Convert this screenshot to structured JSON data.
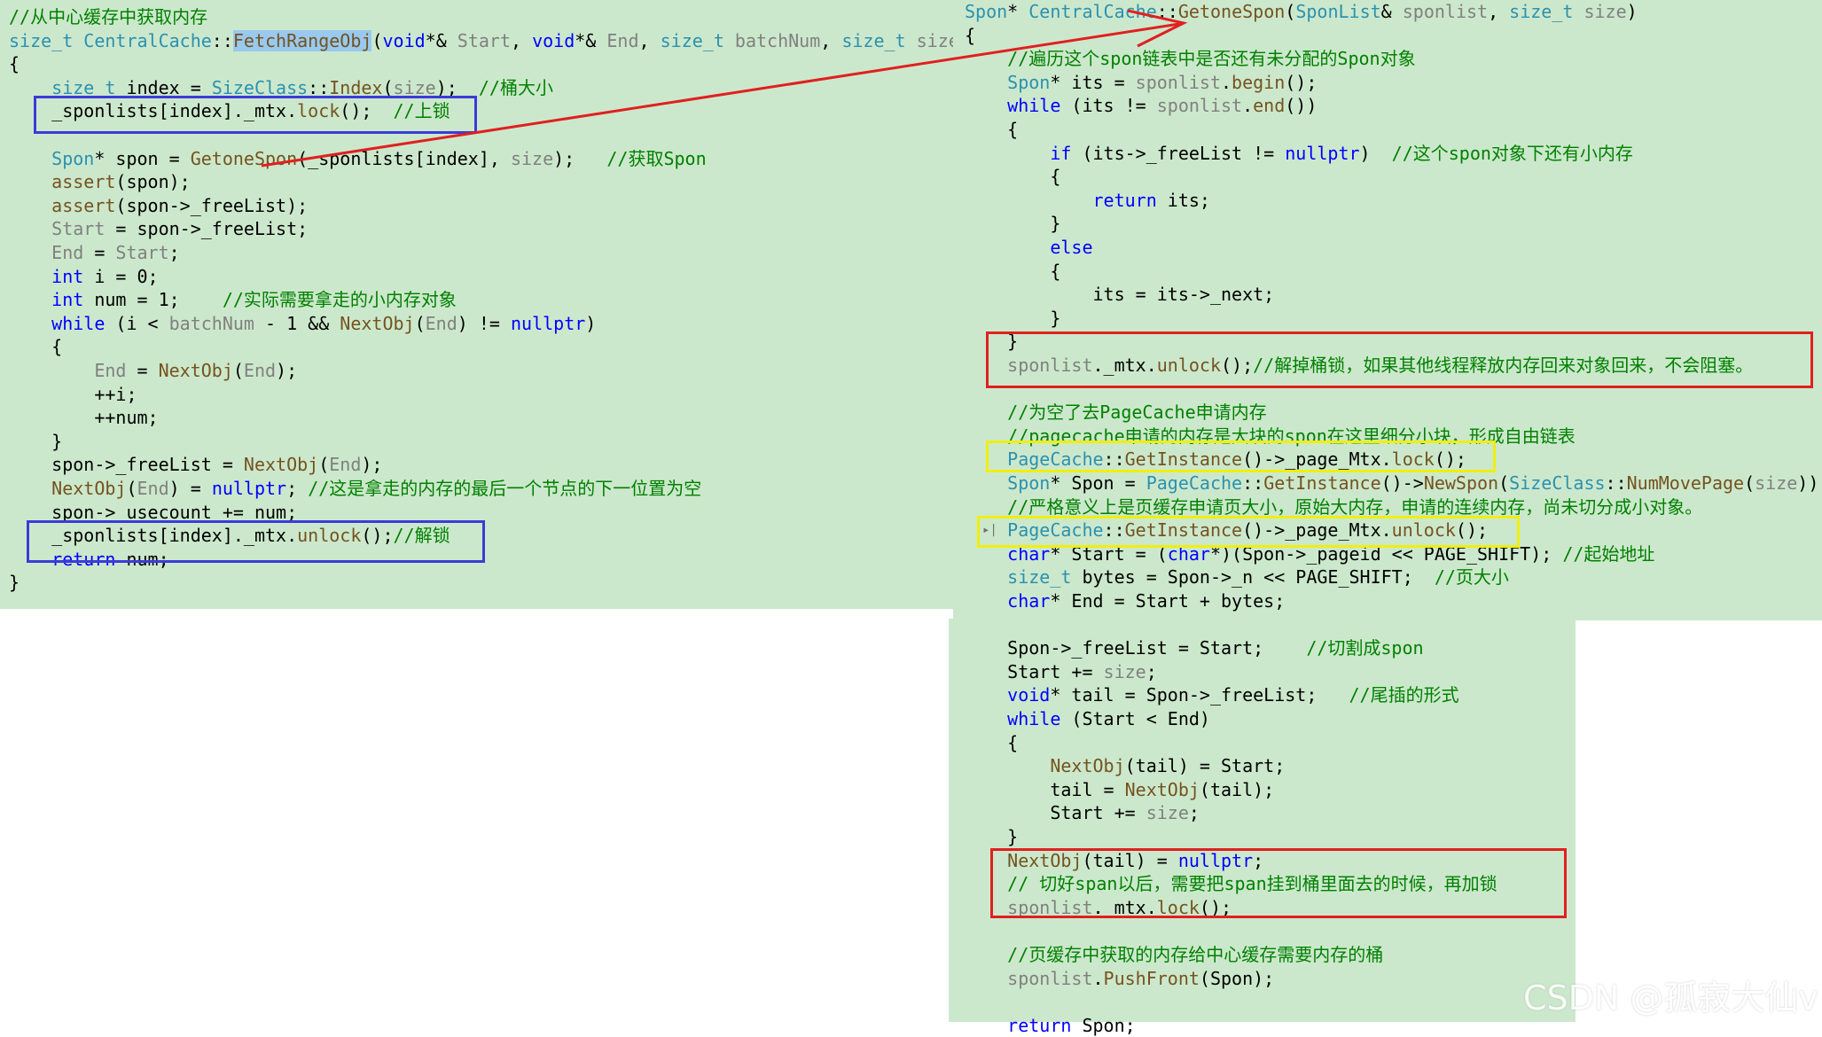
{
  "left_code": [
    [
      {
        "t": "//从中心缓存中获取内存",
        "c": "cm"
      }
    ],
    [
      {
        "t": "size_t ",
        "c": "ty"
      },
      {
        "t": "CentralCache",
        "c": "ty"
      },
      {
        "t": "::",
        "c": "pu"
      },
      {
        "t": "FetchRangeObj",
        "c": "fn",
        "hl": true
      },
      {
        "t": "(",
        "c": "pu"
      },
      {
        "t": "void",
        "c": "kw"
      },
      {
        "t": "*& ",
        "c": "pu"
      },
      {
        "t": "Start",
        "c": "pr"
      },
      {
        "t": ", ",
        "c": "pu"
      },
      {
        "t": "void",
        "c": "kw"
      },
      {
        "t": "*& ",
        "c": "pu"
      },
      {
        "t": "End",
        "c": "pr"
      },
      {
        "t": ", ",
        "c": "pu"
      },
      {
        "t": "size_t ",
        "c": "ty"
      },
      {
        "t": "batchNum",
        "c": "pr"
      },
      {
        "t": ", ",
        "c": "pu"
      },
      {
        "t": "size_t ",
        "c": "ty"
      },
      {
        "t": "size",
        "c": "pr"
      },
      {
        "t": ")",
        "c": "pu"
      }
    ],
    [
      {
        "t": "{",
        "c": "pu"
      }
    ],
    [
      {
        "t": "    "
      },
      {
        "t": "size_t ",
        "c": "ty"
      },
      {
        "t": "index = ",
        "c": "pu"
      },
      {
        "t": "SizeClass",
        "c": "ty"
      },
      {
        "t": "::",
        "c": "pu"
      },
      {
        "t": "Index",
        "c": "fn"
      },
      {
        "t": "(",
        "c": "pu"
      },
      {
        "t": "size",
        "c": "pr"
      },
      {
        "t": ");  ",
        "c": "pu"
      },
      {
        "t": "//桶大小",
        "c": "cm"
      }
    ],
    [
      {
        "t": "    _sponlists[index]._mtx.",
        "c": "pu"
      },
      {
        "t": "lock",
        "c": "fn"
      },
      {
        "t": "();  ",
        "c": "pu"
      },
      {
        "t": "//上锁",
        "c": "cm"
      }
    ],
    [
      {
        "t": ""
      }
    ],
    [
      {
        "t": "    "
      },
      {
        "t": "Spon",
        "c": "ty"
      },
      {
        "t": "* spon = ",
        "c": "pu"
      },
      {
        "t": "GetoneSpon",
        "c": "fn"
      },
      {
        "t": "(_sponlists[index], ",
        "c": "pu"
      },
      {
        "t": "size",
        "c": "pr"
      },
      {
        "t": ");   ",
        "c": "pu"
      },
      {
        "t": "//获取Spon",
        "c": "cm"
      }
    ],
    [
      {
        "t": "    "
      },
      {
        "t": "assert",
        "c": "fn"
      },
      {
        "t": "(spon);",
        "c": "pu"
      }
    ],
    [
      {
        "t": "    "
      },
      {
        "t": "assert",
        "c": "fn"
      },
      {
        "t": "(spon->_freeList);",
        "c": "pu"
      }
    ],
    [
      {
        "t": "    "
      },
      {
        "t": "Start",
        "c": "pr"
      },
      {
        "t": " = spon->_freeList;",
        "c": "pu"
      }
    ],
    [
      {
        "t": "    "
      },
      {
        "t": "End",
        "c": "pr"
      },
      {
        "t": " = ",
        "c": "pu"
      },
      {
        "t": "Start",
        "c": "pr"
      },
      {
        "t": ";",
        "c": "pu"
      }
    ],
    [
      {
        "t": "    "
      },
      {
        "t": "int",
        "c": "kw"
      },
      {
        "t": " i = 0;",
        "c": "pu"
      }
    ],
    [
      {
        "t": "    "
      },
      {
        "t": "int",
        "c": "kw"
      },
      {
        "t": " num = 1;    ",
        "c": "pu"
      },
      {
        "t": "//实际需要拿走的小内存对象",
        "c": "cm"
      }
    ],
    [
      {
        "t": "    "
      },
      {
        "t": "while",
        "c": "kw"
      },
      {
        "t": " (i < ",
        "c": "pu"
      },
      {
        "t": "batchNum",
        "c": "pr"
      },
      {
        "t": " - 1 && ",
        "c": "pu"
      },
      {
        "t": "NextObj",
        "c": "fn"
      },
      {
        "t": "(",
        "c": "pu"
      },
      {
        "t": "End",
        "c": "pr"
      },
      {
        "t": ") != ",
        "c": "pu"
      },
      {
        "t": "nullptr",
        "c": "kw"
      },
      {
        "t": ")",
        "c": "pu"
      }
    ],
    [
      {
        "t": "    {",
        "c": "pu"
      }
    ],
    [
      {
        "t": "        "
      },
      {
        "t": "End",
        "c": "pr"
      },
      {
        "t": " = ",
        "c": "pu"
      },
      {
        "t": "NextObj",
        "c": "fn"
      },
      {
        "t": "(",
        "c": "pu"
      },
      {
        "t": "End",
        "c": "pr"
      },
      {
        "t": ");",
        "c": "pu"
      }
    ],
    [
      {
        "t": "        ++i;",
        "c": "pu"
      }
    ],
    [
      {
        "t": "        ++num;",
        "c": "pu"
      }
    ],
    [
      {
        "t": "    }",
        "c": "pu"
      }
    ],
    [
      {
        "t": "    spon->_freeList = ",
        "c": "pu"
      },
      {
        "t": "NextObj",
        "c": "fn"
      },
      {
        "t": "(",
        "c": "pu"
      },
      {
        "t": "End",
        "c": "pr"
      },
      {
        "t": ");",
        "c": "pu"
      }
    ],
    [
      {
        "t": "    "
      },
      {
        "t": "NextObj",
        "c": "fn"
      },
      {
        "t": "(",
        "c": "pu"
      },
      {
        "t": "End",
        "c": "pr"
      },
      {
        "t": ") = ",
        "c": "pu"
      },
      {
        "t": "nullptr",
        "c": "kw"
      },
      {
        "t": "; ",
        "c": "pu"
      },
      {
        "t": "//这是拿走的内存的最后一个节点的下一位置为空",
        "c": "cm"
      }
    ],
    [
      {
        "t": "    spon->_usecount += num;",
        "c": "pu"
      }
    ],
    [
      {
        "t": "    _sponlists[index]._mtx.",
        "c": "pu"
      },
      {
        "t": "unlock",
        "c": "fn"
      },
      {
        "t": "();",
        "c": "pu"
      },
      {
        "t": "//解锁",
        "c": "cm"
      }
    ],
    [
      {
        "t": "    "
      },
      {
        "t": "return",
        "c": "kw"
      },
      {
        "t": " num;",
        "c": "pu"
      }
    ],
    [
      {
        "t": "}",
        "c": "pu"
      }
    ]
  ],
  "right_code": [
    [
      {
        "t": "Spon",
        "c": "ty"
      },
      {
        "t": "* ",
        "c": "pu"
      },
      {
        "t": "CentralCache",
        "c": "ty"
      },
      {
        "t": "::",
        "c": "pu"
      },
      {
        "t": "GetoneSpon",
        "c": "fn"
      },
      {
        "t": "(",
        "c": "pu"
      },
      {
        "t": "SponList",
        "c": "ty"
      },
      {
        "t": "& ",
        "c": "pu"
      },
      {
        "t": "sponlist",
        "c": "pr"
      },
      {
        "t": ", ",
        "c": "pu"
      },
      {
        "t": "size_t ",
        "c": "ty"
      },
      {
        "t": "size",
        "c": "pr"
      },
      {
        "t": ")",
        "c": "pu"
      }
    ],
    [
      {
        "t": "{",
        "c": "pu"
      }
    ],
    [
      {
        "t": "    "
      },
      {
        "t": "//遍历这个spon链表中是否还有未分配的Spon对象",
        "c": "cm"
      }
    ],
    [
      {
        "t": "    "
      },
      {
        "t": "Spon",
        "c": "ty"
      },
      {
        "t": "* its = ",
        "c": "pu"
      },
      {
        "t": "sponlist",
        "c": "pr"
      },
      {
        "t": ".",
        "c": "pu"
      },
      {
        "t": "begin",
        "c": "fn"
      },
      {
        "t": "();",
        "c": "pu"
      }
    ],
    [
      {
        "t": "    "
      },
      {
        "t": "while",
        "c": "kw"
      },
      {
        "t": " (its != ",
        "c": "pu"
      },
      {
        "t": "sponlist",
        "c": "pr"
      },
      {
        "t": ".",
        "c": "pu"
      },
      {
        "t": "end",
        "c": "fn"
      },
      {
        "t": "())",
        "c": "pu"
      }
    ],
    [
      {
        "t": "    {",
        "c": "pu"
      }
    ],
    [
      {
        "t": "        "
      },
      {
        "t": "if",
        "c": "kw"
      },
      {
        "t": " (its->_freeList != ",
        "c": "pu"
      },
      {
        "t": "nullptr",
        "c": "kw"
      },
      {
        "t": ")  ",
        "c": "pu"
      },
      {
        "t": "//这个spon对象下还有小内存",
        "c": "cm"
      }
    ],
    [
      {
        "t": "        {",
        "c": "pu"
      }
    ],
    [
      {
        "t": "            "
      },
      {
        "t": "return",
        "c": "kw"
      },
      {
        "t": " its;",
        "c": "pu"
      }
    ],
    [
      {
        "t": "        }",
        "c": "pu"
      }
    ],
    [
      {
        "t": "        "
      },
      {
        "t": "else",
        "c": "kw"
      }
    ],
    [
      {
        "t": "        {",
        "c": "pu"
      }
    ],
    [
      {
        "t": "            its = its->_next;",
        "c": "pu"
      }
    ],
    [
      {
        "t": "        }",
        "c": "pu"
      }
    ],
    [
      {
        "t": "    }",
        "c": "pu"
      }
    ],
    [
      {
        "t": "    "
      },
      {
        "t": "sponlist",
        "c": "pr"
      },
      {
        "t": "._mtx.",
        "c": "pu"
      },
      {
        "t": "unlock",
        "c": "fn"
      },
      {
        "t": "();",
        "c": "pu"
      },
      {
        "t": "//解掉桶锁，如果其他线程释放内存回来对象回来，不会阻塞。",
        "c": "cm"
      }
    ],
    [
      {
        "t": ""
      }
    ],
    [
      {
        "t": "    "
      },
      {
        "t": "//为空了去PageCache申请内存",
        "c": "cm"
      }
    ],
    [
      {
        "t": "    "
      },
      {
        "t": "//pagecache申请的内存是大块的spon在这里细分小块，形成自由链表",
        "c": "cm"
      }
    ],
    [
      {
        "t": "    "
      },
      {
        "t": "PageCache",
        "c": "ty"
      },
      {
        "t": "::",
        "c": "pu"
      },
      {
        "t": "GetInstance",
        "c": "fn"
      },
      {
        "t": "()->_page_Mtx.",
        "c": "pu"
      },
      {
        "t": "lock",
        "c": "fn"
      },
      {
        "t": "();",
        "c": "pu"
      }
    ],
    [
      {
        "t": "    "
      },
      {
        "t": "Spon",
        "c": "ty"
      },
      {
        "t": "* Spon = ",
        "c": "pu"
      },
      {
        "t": "PageCache",
        "c": "ty"
      },
      {
        "t": "::",
        "c": "pu"
      },
      {
        "t": "GetInstance",
        "c": "fn"
      },
      {
        "t": "()->",
        "c": "pu"
      },
      {
        "t": "NewSpon",
        "c": "fn"
      },
      {
        "t": "(",
        "c": "pu"
      },
      {
        "t": "SizeClass",
        "c": "ty"
      },
      {
        "t": "::",
        "c": "pu"
      },
      {
        "t": "NumMovePage",
        "c": "fn"
      },
      {
        "t": "(",
        "c": "pu"
      },
      {
        "t": "size",
        "c": "pr"
      },
      {
        "t": "));",
        "c": "pu"
      }
    ],
    [
      {
        "t": "    "
      },
      {
        "t": "//严格意义上是页缓存申请页大小，原始大内存，申请的连续内存，尚未切分成小对象。",
        "c": "cm"
      }
    ],
    [
      {
        "t": "    "
      },
      {
        "t": "PageCache",
        "c": "ty"
      },
      {
        "t": "::",
        "c": "pu"
      },
      {
        "t": "GetInstance",
        "c": "fn"
      },
      {
        "t": "()->_page_Mtx.",
        "c": "pu"
      },
      {
        "t": "unlock",
        "c": "fn"
      },
      {
        "t": "();",
        "c": "pu"
      }
    ],
    [
      {
        "t": "    "
      },
      {
        "t": "char",
        "c": "kw"
      },
      {
        "t": "* Start = (",
        "c": "pu"
      },
      {
        "t": "char",
        "c": "kw"
      },
      {
        "t": "*)(Spon->_pageid << PAGE_SHIFT); ",
        "c": "pu"
      },
      {
        "t": "//起始地址",
        "c": "cm"
      }
    ],
    [
      {
        "t": "    "
      },
      {
        "t": "size_t ",
        "c": "ty"
      },
      {
        "t": "bytes = Spon->_n << PAGE_SHIFT;  ",
        "c": "pu"
      },
      {
        "t": "//页大小",
        "c": "cm"
      }
    ],
    [
      {
        "t": "    "
      },
      {
        "t": "char",
        "c": "kw"
      },
      {
        "t": "* End = Start + bytes;",
        "c": "pu"
      }
    ],
    [
      {
        "t": ""
      }
    ],
    [
      {
        "t": "    Spon->_freeList = Start;    ",
        "c": "pu"
      },
      {
        "t": "//切割成spon",
        "c": "cm"
      }
    ],
    [
      {
        "t": "    Start += ",
        "c": "pu"
      },
      {
        "t": "size",
        "c": "pr"
      },
      {
        "t": ";",
        "c": "pu"
      }
    ],
    [
      {
        "t": "    "
      },
      {
        "t": "void",
        "c": "kw"
      },
      {
        "t": "* tail = Spon->_freeList;   ",
        "c": "pu"
      },
      {
        "t": "//尾插的形式",
        "c": "cm"
      }
    ],
    [
      {
        "t": "    "
      },
      {
        "t": "while",
        "c": "kw"
      },
      {
        "t": " (Start < End)",
        "c": "pu"
      }
    ],
    [
      {
        "t": "    {",
        "c": "pu"
      }
    ],
    [
      {
        "t": "        "
      },
      {
        "t": "NextObj",
        "c": "fn"
      },
      {
        "t": "(tail) = Start;",
        "c": "pu"
      }
    ],
    [
      {
        "t": "        tail = ",
        "c": "pu"
      },
      {
        "t": "NextObj",
        "c": "fn"
      },
      {
        "t": "(tail);",
        "c": "pu"
      }
    ],
    [
      {
        "t": "        Start += ",
        "c": "pu"
      },
      {
        "t": "size",
        "c": "pr"
      },
      {
        "t": ";",
        "c": "pu"
      }
    ],
    [
      {
        "t": "    }",
        "c": "pu"
      }
    ],
    [
      {
        "t": "    "
      },
      {
        "t": "NextObj",
        "c": "fn"
      },
      {
        "t": "(tail) = ",
        "c": "pu"
      },
      {
        "t": "nullptr",
        "c": "kw"
      },
      {
        "t": ";",
        "c": "pu"
      }
    ],
    [
      {
        "t": "    "
      },
      {
        "t": "// 切好span以后，需要把span挂到桶里面去的时候，再加锁",
        "c": "cm"
      }
    ],
    [
      {
        "t": "    "
      },
      {
        "t": "sponlist",
        "c": "pr"
      },
      {
        "t": "._mtx.",
        "c": "pu"
      },
      {
        "t": "lock",
        "c": "fn"
      },
      {
        "t": "();",
        "c": "pu"
      }
    ],
    [
      {
        "t": ""
      }
    ],
    [
      {
        "t": "    "
      },
      {
        "t": "//页缓存中获取的内存给中心缓存需要内存的桶",
        "c": "cm"
      }
    ],
    [
      {
        "t": "    "
      },
      {
        "t": "sponlist",
        "c": "pr"
      },
      {
        "t": ".",
        "c": "pu"
      },
      {
        "t": "PushFront",
        "c": "fn"
      },
      {
        "t": "(Spon);",
        "c": "pu"
      }
    ],
    [
      {
        "t": ""
      }
    ],
    [
      {
        "t": "    "
      },
      {
        "t": "return",
        "c": "kw"
      },
      {
        "t": " Spon;",
        "c": "pu"
      }
    ]
  ],
  "watermark": "CSDN @孤寂大仙v",
  "colors": {
    "panel_bg": "#cce8cc",
    "keyword": "#0000ff",
    "type": "#2b91af",
    "function": "#74531f",
    "param": "#808080",
    "comment": "#008000",
    "box_blue": "#3b3bd8",
    "box_red": "#e02020",
    "box_yellow": "#f0ef10",
    "arrow": "#e02020"
  }
}
